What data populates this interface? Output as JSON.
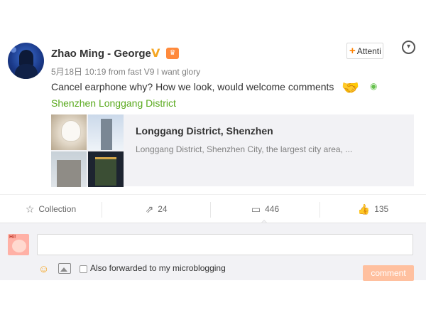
{
  "post": {
    "author": {
      "name": "Zhao Ming - George",
      "verified_icon": "v-badge-icon",
      "level_icon": "level-badge-icon"
    },
    "follow_button": {
      "label": "Attenti"
    },
    "meta": "5月18日 10:19 from fast V9 I want glory",
    "text": "Cancel earphone why? How we look, would welcome comments",
    "location": "Shenzhen Longgang District",
    "card": {
      "title": "Longgang District, Shenzhen",
      "description": "Longgang District, Shenzhen City, the largest city area, ..."
    }
  },
  "actions": {
    "collection": {
      "label": "Collection",
      "icon": "star-icon"
    },
    "forward": {
      "count": "24",
      "icon": "share-icon"
    },
    "comment": {
      "count": "446",
      "icon": "comment-icon"
    },
    "like": {
      "count": "135",
      "icon": "like-icon"
    }
  },
  "comment_box": {
    "input_value": "",
    "forward_label": "Also forwarded to my microblogging",
    "forward_checked": false,
    "submit_label": "comment"
  },
  "colors": {
    "accent_orange": "#ff8200",
    "location_green": "#5aaa1e",
    "verified_gold": "#f5a623",
    "submit_disabled": "#ffc09f"
  }
}
